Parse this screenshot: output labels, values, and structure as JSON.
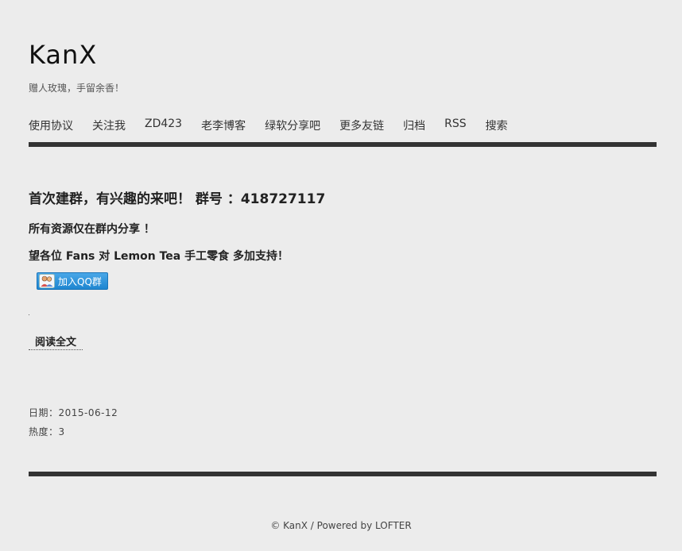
{
  "site": {
    "title": "KanX",
    "description": "赠人玫瑰，手留余香！"
  },
  "nav": {
    "items": [
      {
        "label": "使用协议"
      },
      {
        "label": "关注我"
      },
      {
        "label": "ZD423"
      },
      {
        "label": "老李博客"
      },
      {
        "label": "绿软分享吧"
      },
      {
        "label": "更多友链"
      },
      {
        "label": "归档"
      },
      {
        "label": "RSS"
      },
      {
        "label": "搜索"
      }
    ]
  },
  "post": {
    "title": "首次建群，有兴趣的来吧！ 群号 ：418727117",
    "line1": "所有资源仅在群内分享 ！",
    "line2": "望各位 Fans 对 Lemon Tea 手工零食 多加支持！",
    "qq_button_label": "加入QQ群",
    "read_more": "阅读全文",
    "date": "日期：2015-06-12",
    "heat": "热度：3"
  },
  "footer": {
    "text": "© KanX / Powered by LOFTER"
  },
  "colors": {
    "background": "#ececec",
    "bar": "#333333",
    "qq_button": "#1e86d0"
  }
}
